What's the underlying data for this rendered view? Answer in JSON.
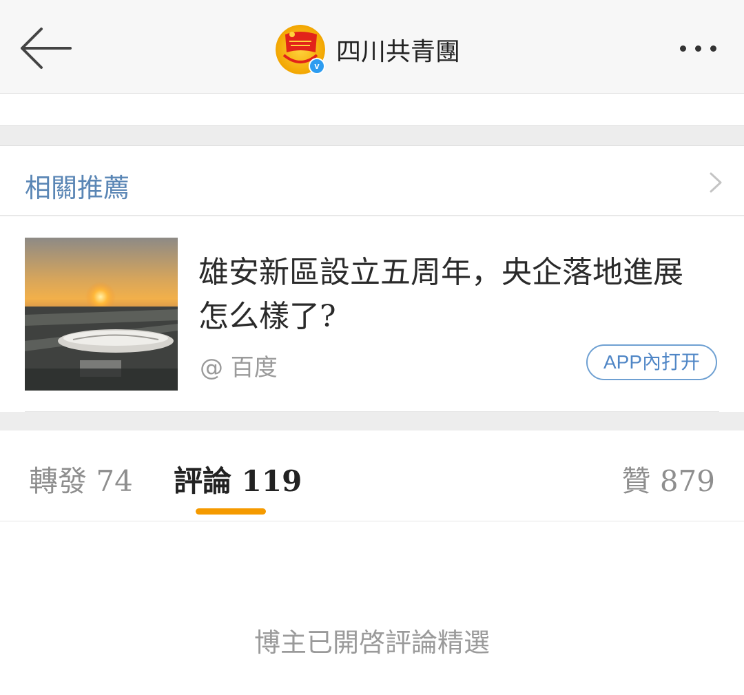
{
  "header": {
    "back_icon": "back-arrow-icon",
    "account_name": "四川共青團",
    "verified_mark": "v",
    "more_icon": "more-dots-icon"
  },
  "related": {
    "title": "相關推薦",
    "chevron_icon": "chevron-right-icon",
    "article": {
      "title": "雄安新區設立五周年，央企落地進展怎么樣了?",
      "source": "@ 百度",
      "open_in_app_label": "APP內打开"
    }
  },
  "stats": {
    "reposts_label": "轉發 74",
    "comments_label": "評論 119",
    "likes_label": "贊 879",
    "active_tab": "comments",
    "active_color": "#f59a00"
  },
  "notice": "博主已開啓評論精選",
  "colors": {
    "link_blue": "#5a86b5",
    "verified_blue": "#2d9cf0",
    "accent_orange": "#f59a00"
  }
}
